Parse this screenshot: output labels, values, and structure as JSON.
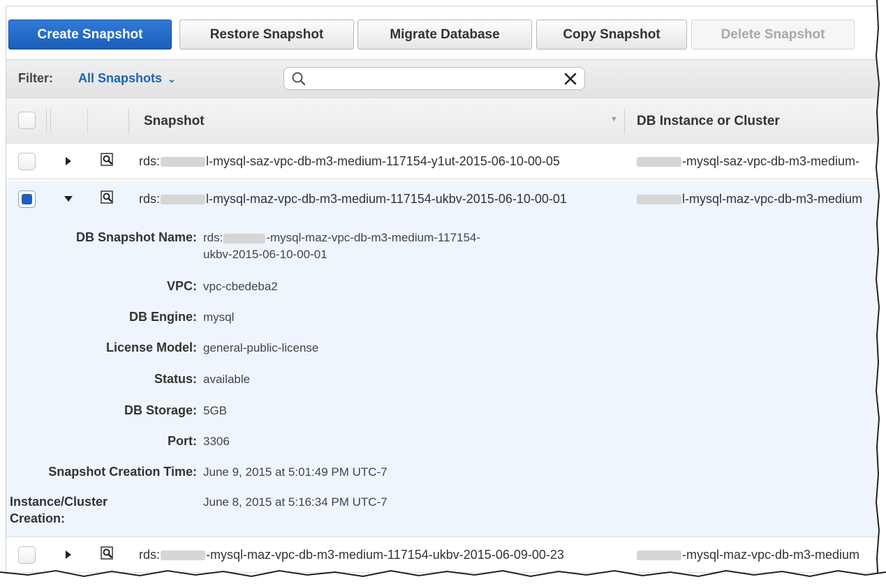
{
  "toolbar": {
    "create": "Create Snapshot",
    "restore": "Restore Snapshot",
    "migrate": "Migrate Database",
    "copy": "Copy Snapshot",
    "delete": "Delete Snapshot"
  },
  "filter": {
    "label": "Filter:",
    "selected": "All Snapshots",
    "search_value": ""
  },
  "table": {
    "columns": [
      "Snapshot",
      "DB Instance or Cluster"
    ]
  },
  "rows": [
    {
      "snapshot_prefix": "rds:",
      "snapshot_suffix": "l-mysql-saz-vpc-db-m3-medium-117154-y1ut-2015-06-10-00-05",
      "instance": "-mysql-saz-vpc-db-m3-medium-",
      "checked": false,
      "expanded": false
    },
    {
      "snapshot_prefix": "rds:",
      "snapshot_suffix": "l-mysql-maz-vpc-db-m3-medium-117154-ukbv-2015-06-10-00-01",
      "instance": "l-mysql-maz-vpc-db-m3-medium",
      "checked": true,
      "expanded": true
    },
    {
      "snapshot_prefix": "rds:",
      "snapshot_suffix": "-mysql-maz-vpc-db-m3-medium-117154-ukbv-2015-06-09-00-23",
      "instance": "-mysql-maz-vpc-db-m3-medium",
      "checked": false,
      "expanded": false
    }
  ],
  "details": {
    "name_label": "DB Snapshot Name:",
    "name_prefix": "rds:",
    "name_line1": "-mysql-maz-vpc-db-m3-medium-117154-",
    "name_line2": "ukbv-2015-06-10-00-01",
    "vpc_label": "VPC:",
    "vpc": "vpc-cbedeba2",
    "engine_label": "DB Engine:",
    "engine": "mysql",
    "license_label": "License Model:",
    "license": "general-public-license",
    "status_label": "Status:",
    "status": "available",
    "storage_label": "DB Storage:",
    "storage": "5GB",
    "port_label": "Port:",
    "port": "3306",
    "creation_label": "Snapshot Creation Time:",
    "creation": "June 9, 2015 at 5:01:49 PM UTC-7",
    "instance_creation_label_1": "Instance/Cluster",
    "instance_creation_label_2": "Creation:",
    "instance_creation": "June 8, 2015 at 5:16:34 PM UTC-7"
  },
  "icons": {
    "search": "search-icon",
    "clear": "close-icon",
    "expand": "chevron-right-icon",
    "collapse": "chevron-down-icon",
    "inspect": "magnifier-icon"
  },
  "colors": {
    "primary": "#1a5eb8",
    "link": "#1b64b5",
    "selected_row": "#eef5fc"
  }
}
